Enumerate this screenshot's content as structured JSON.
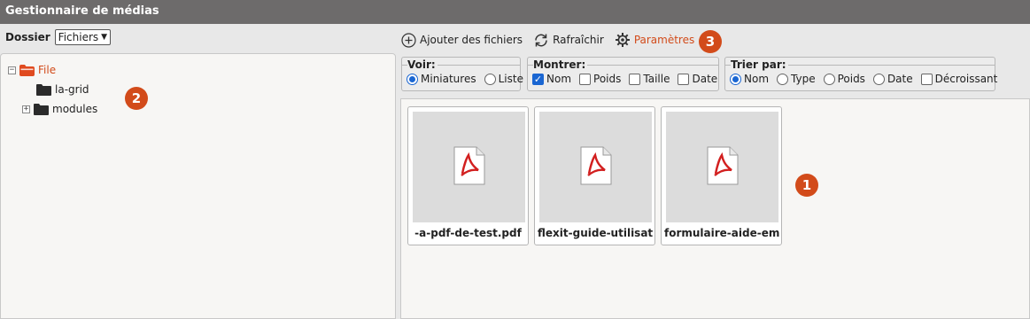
{
  "app": {
    "title": "Gestionnaire de médias"
  },
  "folder_picker": {
    "label": "Dossier",
    "selected": "Fichiers"
  },
  "tree": {
    "root": {
      "label": "File",
      "toggle": "⊟"
    },
    "children": [
      {
        "label": "la-grid",
        "toggle": ""
      },
      {
        "label": "modules",
        "toggle": "⊞"
      }
    ]
  },
  "toolbar": {
    "add_label": "Ajouter des fichiers",
    "refresh_label": "Rafraîchir",
    "settings_label": "Paramètres"
  },
  "filters": {
    "voir": {
      "legend": "Voir:",
      "options": [
        {
          "label": "Miniatures",
          "checked": true
        },
        {
          "label": "Liste",
          "checked": false
        }
      ]
    },
    "montrer": {
      "legend": "Montrer:",
      "options": [
        {
          "label": "Nom",
          "checked": true
        },
        {
          "label": "Poids",
          "checked": false
        },
        {
          "label": "Taille",
          "checked": false
        },
        {
          "label": "Date",
          "checked": false
        }
      ]
    },
    "trier": {
      "legend": "Trier par:",
      "options": [
        {
          "label": "Nom",
          "checked": true
        },
        {
          "label": "Type",
          "checked": false
        },
        {
          "label": "Poids",
          "checked": false
        },
        {
          "label": "Date",
          "checked": false
        },
        {
          "label": "Décroissant",
          "checked": false
        }
      ]
    }
  },
  "files": [
    {
      "name": "-a-pdf-de-test.pdf",
      "icon": "pdf-icon"
    },
    {
      "name": "flexit-guide-utilisat",
      "icon": "pdf-icon"
    },
    {
      "name": "formulaire-aide-em",
      "icon": "pdf-icon"
    }
  ],
  "badges": {
    "one": "1",
    "two": "2",
    "three": "3"
  },
  "colors": {
    "accent": "#d24b1a",
    "titlebar": "#6d6b6b",
    "selection": "#1a66d2"
  }
}
